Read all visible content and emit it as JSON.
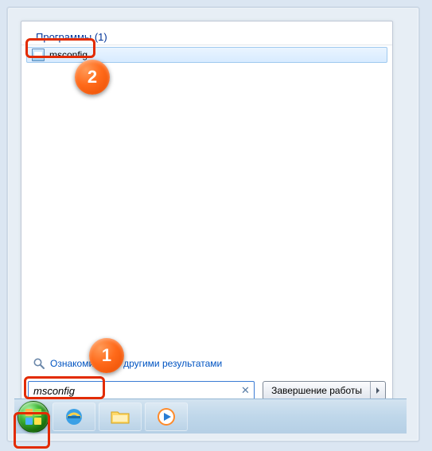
{
  "search": {
    "category_label": "Программы (1)",
    "result_label": "msconfig",
    "more_results_label": "Ознакомиться с другими результатами",
    "input_value": "msconfig"
  },
  "shutdown": {
    "label": "Завершение работы"
  },
  "annotations": {
    "badge1": "1",
    "badge2": "2"
  },
  "icons": {
    "result": "msconfig-icon",
    "search": "magnifier-icon",
    "clear": "clear-x-icon",
    "shutdown_arrow": "chevron-right-icon",
    "start": "windows-orb-icon",
    "ie": "internet-explorer-icon",
    "explorer": "file-explorer-icon",
    "wmp": "media-player-icon"
  }
}
